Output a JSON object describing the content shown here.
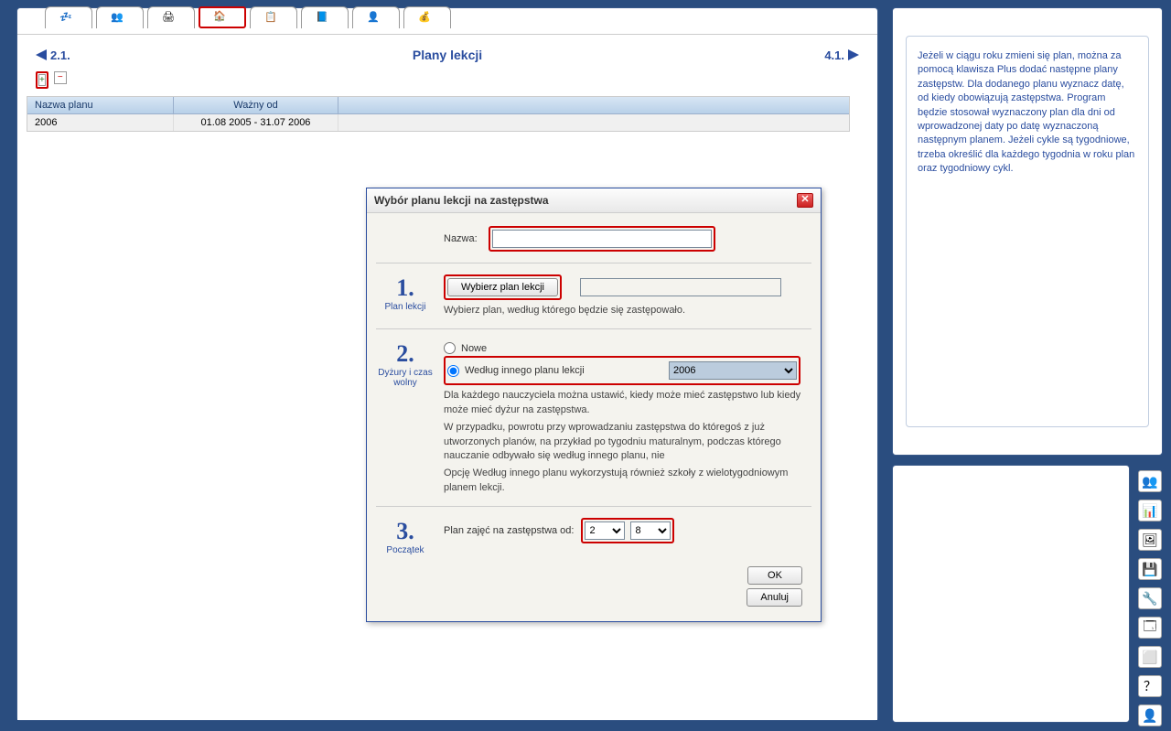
{
  "header": {
    "nav_left": "2.1.",
    "title": "Plany lekcji",
    "nav_right": "4.1."
  },
  "icons": {
    "add": "+",
    "remove": "−"
  },
  "table": {
    "headers": {
      "name": "Nazwa planu",
      "valid": "Ważny od"
    },
    "rows": [
      {
        "name": "2006",
        "valid": "01.08 2005 - 31.07 2006"
      }
    ]
  },
  "dialog": {
    "title": "Wybór planu lekcji na zastępstwa",
    "name_label": "Nazwa:",
    "name_value": "",
    "step1_num": "1.",
    "step1_label": "Plan lekcji",
    "choose_btn": "Wybierz plan lekcji",
    "chosen_value": "",
    "step1_desc": "Wybierz plan, według którego będzie się zastępowało.",
    "step2_num": "2.",
    "step2_label": "Dyżury i czas wolny",
    "radio_new": "Nowe",
    "radio_plan": "Według innego planu lekcji",
    "plan_select": "2006",
    "step2_desc1": "Dla każdego nauczyciela można ustawić, kiedy może mieć zastępstwo lub kiedy może mieć dyżur na zastępstwa.",
    "step2_desc2": "W przypadku, powrotu przy wprowadzaniu zastępstwa do któregoś z już utworzonych planów, na przykład po tygodniu maturalnym, podczas którego nauczanie odbywało się według innego planu, nie",
    "step2_desc3": "Opcję Według innego planu wykorzystują również szkoły z wielotygodniowym planem lekcji.",
    "step3_num": "3.",
    "step3_label": "Początek",
    "step3_prompt": "Plan zajęć na zastępstwa od:",
    "day_value": "2",
    "month_value": "8",
    "ok": "OK",
    "cancel": "Anuluj"
  },
  "help": {
    "text": "Jeżeli w ciągu roku zmieni się plan, można za pomocą klawisza Plus dodać następne plany zastępstw. Dla dodanego planu wyznacz datę, od kiedy obowiązują zastępstwa. Program będzie stosował wyznaczony plan dla dni od wprowadzonej daty po datę wyznaczoną następnym planem. Jeżeli cykle są tygodniowe, trzeba określić dla każdego tygodnia w roku plan oraz tygodniowy cykl."
  },
  "side_icons": [
    "👥",
    "📊",
    "🖼",
    "💾",
    "🔧",
    "🗔",
    "⬜",
    "？",
    "👤"
  ]
}
